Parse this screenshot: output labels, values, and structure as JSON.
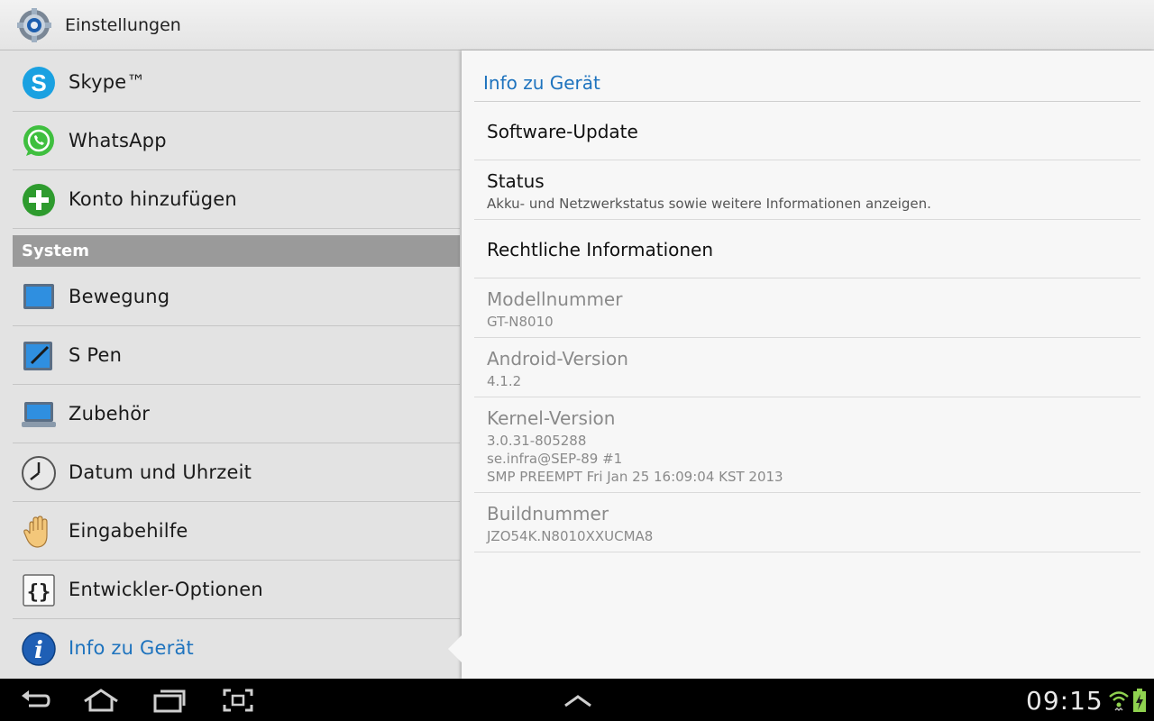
{
  "window": {
    "title": "Einstellungen",
    "icon": "settings-gear-icon"
  },
  "sidebar": {
    "items": [
      {
        "label": "Skype™",
        "icon": "skype-icon"
      },
      {
        "label": "WhatsApp",
        "icon": "whatsapp-icon"
      },
      {
        "label": "Konto hinzufügen",
        "icon": "add-account-icon"
      }
    ],
    "section_label": "System",
    "system_items": [
      {
        "label": "Bewegung",
        "icon": "motion-icon"
      },
      {
        "label": "S Pen",
        "icon": "s-pen-icon"
      },
      {
        "label": "Zubehör",
        "icon": "accessory-icon"
      },
      {
        "label": "Datum und Uhrzeit",
        "icon": "clock-icon"
      },
      {
        "label": "Eingabehilfe",
        "icon": "hand-icon"
      },
      {
        "label": "Entwickler-Optionen",
        "icon": "developer-icon"
      },
      {
        "label": "Info zu Gerät",
        "icon": "info-icon",
        "active": true
      }
    ]
  },
  "detail": {
    "header": "Info zu Gerät",
    "items": [
      {
        "title": "Software-Update"
      },
      {
        "title": "Status",
        "subtitle": "Akku- und Netzwerkstatus sowie weitere Informationen anzeigen."
      },
      {
        "title": "Rechtliche Informationen"
      },
      {
        "title": "Modellnummer",
        "value": "GT-N8010"
      },
      {
        "title": "Android-Version",
        "value": "4.1.2"
      },
      {
        "title": "Kernel-Version",
        "value_lines": [
          "3.0.31-805288",
          "se.infra@SEP-89 #1",
          "SMP PREEMPT Fri Jan 25 16:09:04 KST 2013"
        ]
      },
      {
        "title": "Buildnummer",
        "value": "JZO54K.N8010XXUCMA8"
      }
    ]
  },
  "navbar": {
    "buttons": [
      "back-icon",
      "home-icon",
      "recent-apps-icon",
      "screenshot-icon",
      "chevron-up-icon"
    ],
    "clock": "09:15",
    "status_icons": [
      "wifi-icon",
      "battery-charging-icon"
    ]
  },
  "colors": {
    "accent": "#1e73be",
    "section_bg": "#9a9a9a",
    "navbar_bg": "#000000"
  }
}
